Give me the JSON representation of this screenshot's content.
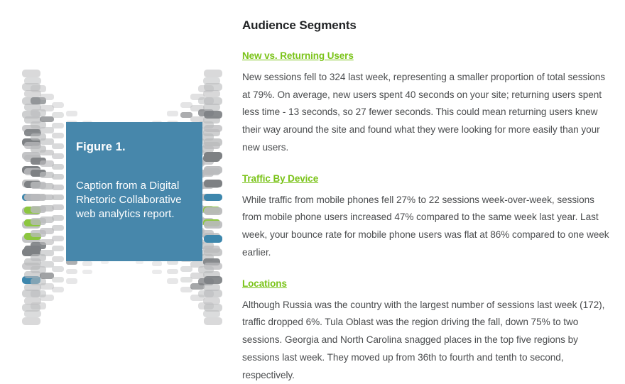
{
  "figure": {
    "number_label": "Figure 1.",
    "caption": "Caption from a Digital Rhetoric Collaborative web analytics report.",
    "colors": {
      "box_blue": "#4787ab",
      "tile_gray": "#b9babc",
      "tile_blue": "#3d87ad",
      "tile_green": "#8cc63f"
    }
  },
  "report": {
    "title": "Audience Segments",
    "sections": [
      {
        "link_label": "New vs. Returning Users",
        "body": "New sessions fell to 324 last week, representing a smaller proportion of total sessions at 79%. On average, new users spent 40 seconds on your site; returning users spent less time - 13 seconds, so 27 fewer seconds. This could mean returning users knew their way around the site and found what they were looking for more easily than your new users."
      },
      {
        "link_label": "Traffic By Device",
        "body": "While traffic from mobile phones fell 27% to 22 sessions week-over-week, sessions from mobile phone users increased 47% compared to the same week last year. Last week, your bounce rate for mobile phone users was flat at 86% compared to one week earlier."
      },
      {
        "link_label": "Locations",
        "body": "Although Russia was the country with the largest number of sessions last week (172), traffic dropped 6%. Tula Oblast was the region driving the fall, down 75% to two sessions. Georgia and North Carolina snagged places in the top five regions by sessions last week. They moved up from 36th to fourth and tenth to second, respectively."
      }
    ],
    "colors": {
      "link_green": "#7ac318",
      "heading_dark": "#222426",
      "body_gray": "#4b4d4f"
    }
  }
}
